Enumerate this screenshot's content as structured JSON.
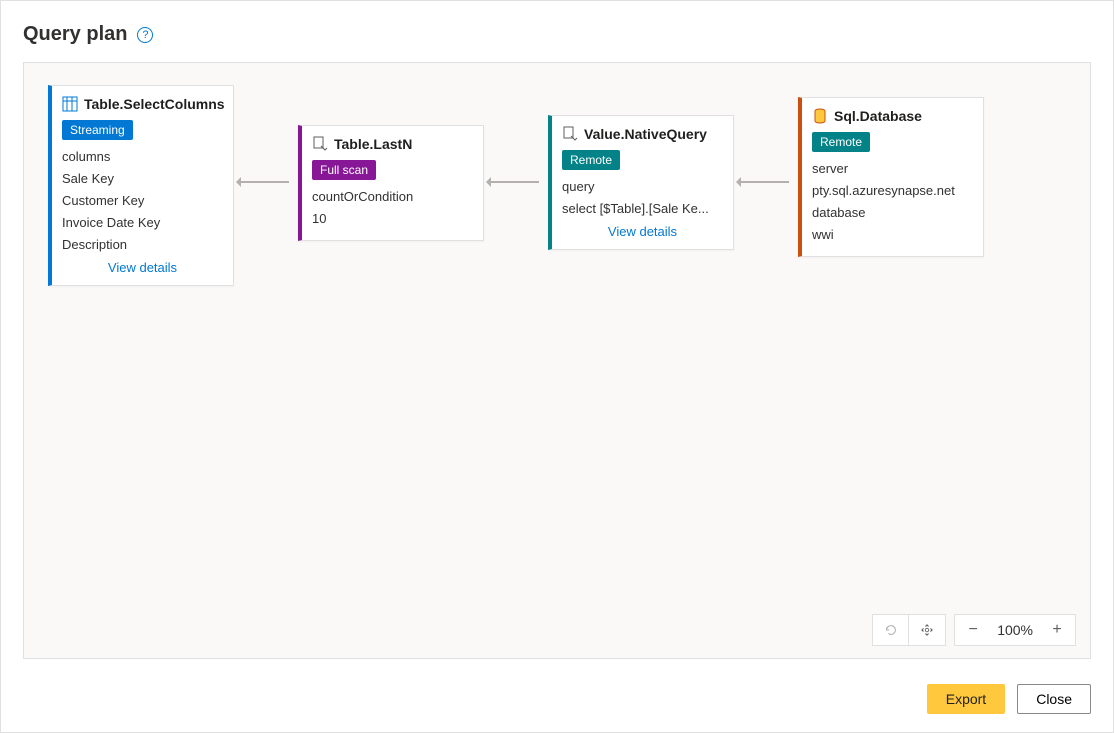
{
  "title": "Query plan",
  "nodes": {
    "n1": {
      "title": "Table.SelectColumns",
      "badge": "Streaming",
      "lines": [
        "columns",
        "Sale Key",
        "Customer Key",
        "Invoice Date Key",
        "Description"
      ],
      "view_details": "View details"
    },
    "n2": {
      "title": "Table.LastN",
      "badge": "Full scan",
      "lines": [
        "countOrCondition",
        "10"
      ]
    },
    "n3": {
      "title": "Value.NativeQuery",
      "badge": "Remote",
      "lines": [
        "query",
        "select [$Table].[Sale Ke..."
      ],
      "view_details": "View details"
    },
    "n4": {
      "title": "Sql.Database",
      "badge": "Remote",
      "lines": [
        "server",
        "pty.sql.azuresynapse.net",
        "database",
        "wwi"
      ]
    }
  },
  "zoom": "100%",
  "buttons": {
    "export": "Export",
    "close": "Close"
  }
}
